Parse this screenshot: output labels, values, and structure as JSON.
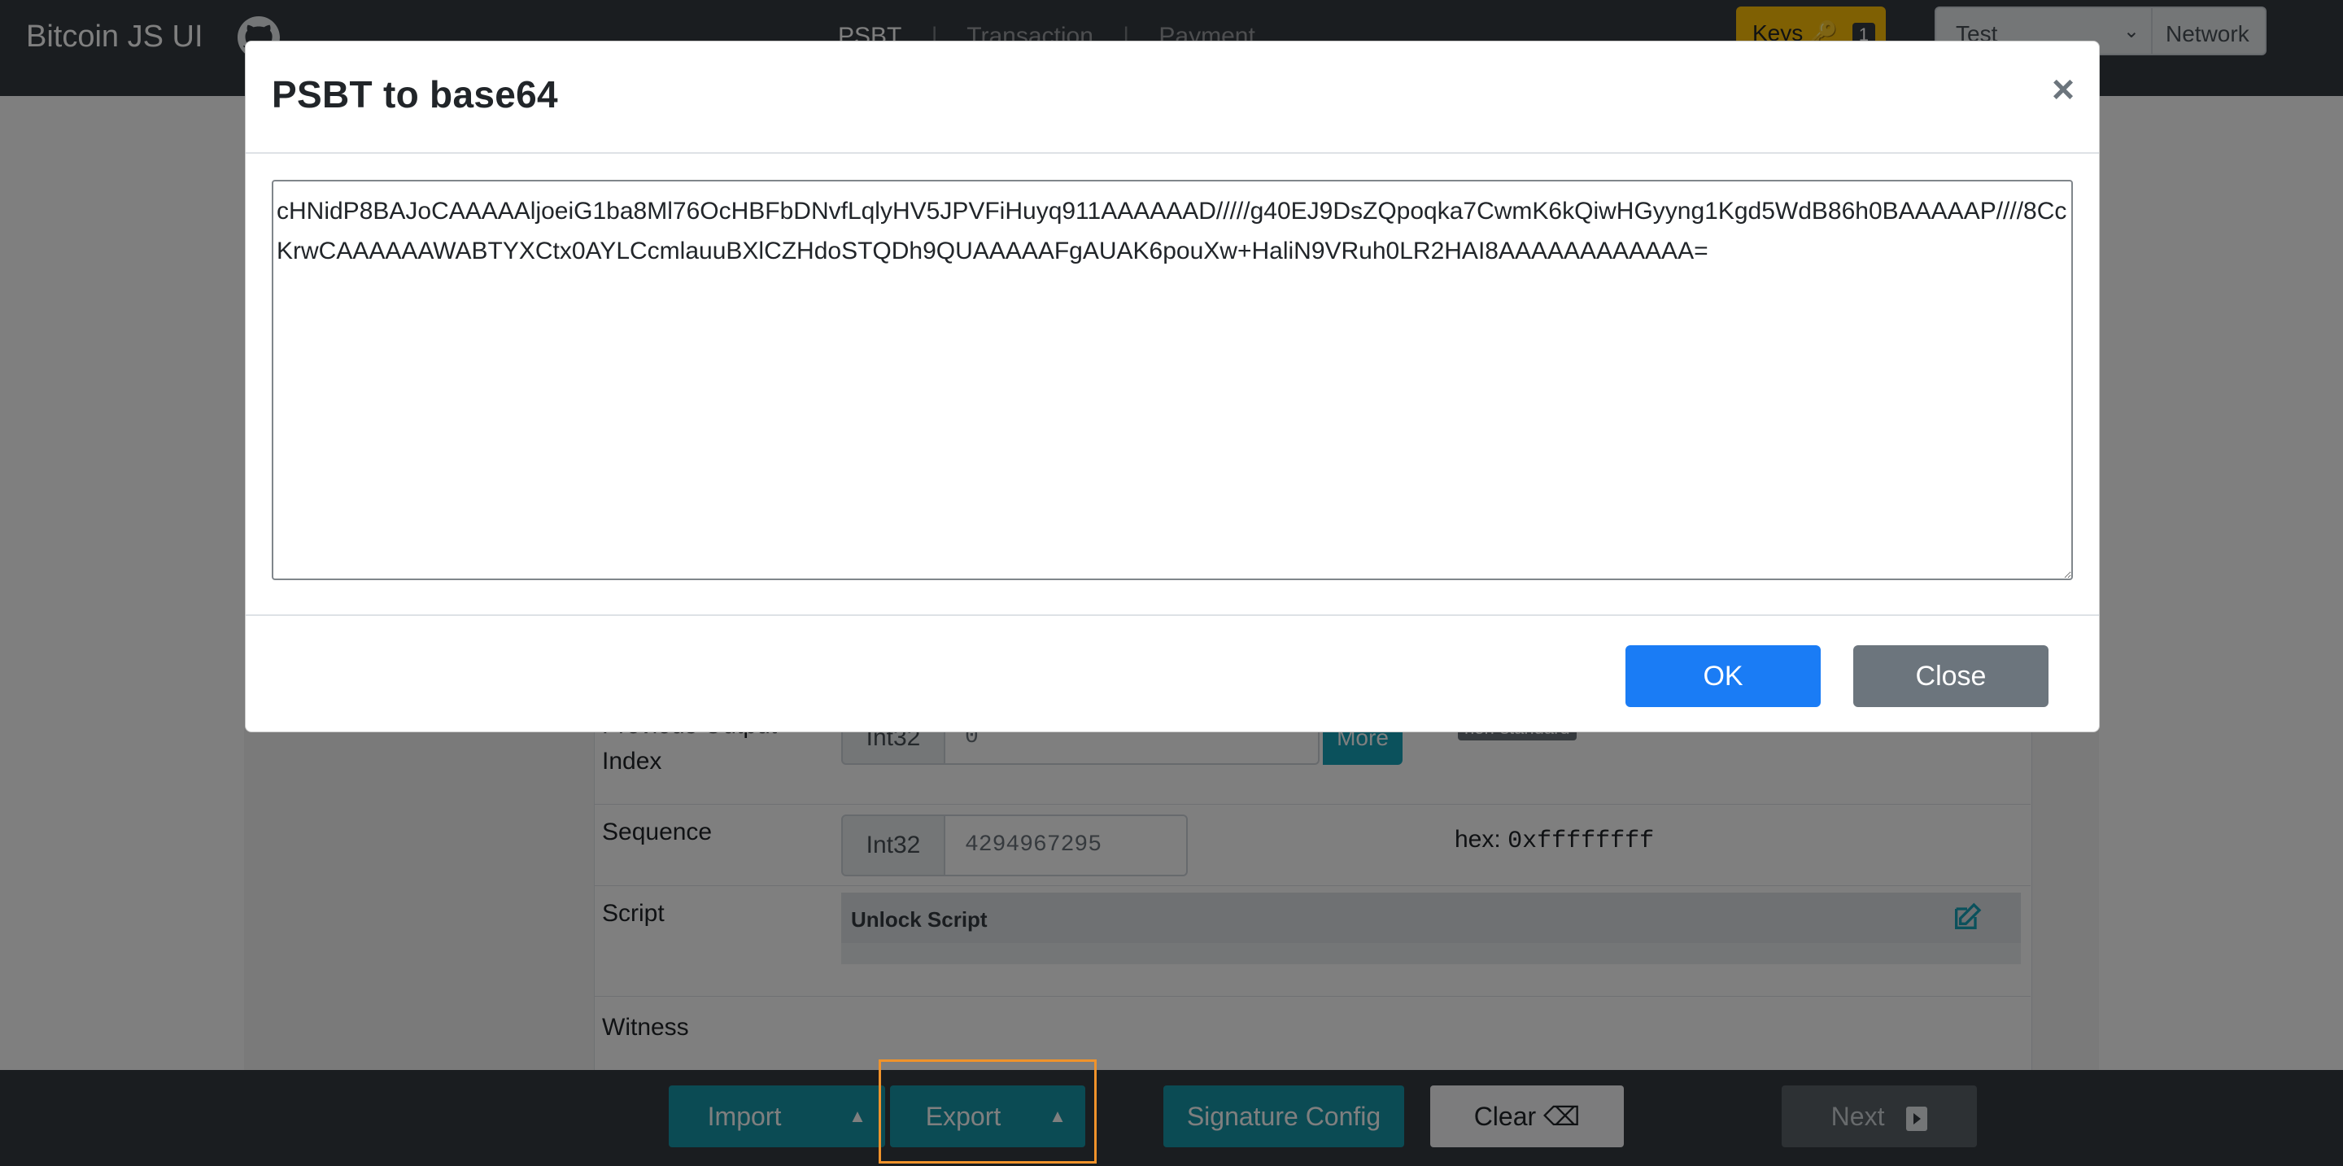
{
  "navbar": {
    "brand": "Bitcoin JS UI",
    "tabs": [
      {
        "label": "PSBT",
        "active": true
      },
      {
        "label": "Transaction",
        "active": false
      },
      {
        "label": "Payment",
        "active": false
      }
    ],
    "separator": "|",
    "keys_label": "Keys",
    "keys_count": "1",
    "network_value": "Test",
    "network_label": "Network"
  },
  "page": {
    "rows": [
      {
        "label": "Previous Output Index",
        "type_label": "Int32",
        "value": "0",
        "more_label": "More",
        "note": "non-standard"
      },
      {
        "label": "Sequence",
        "type_label": "Int32",
        "value": "4294967295",
        "hex_prefix": "hex:",
        "hex_value": "0xffffffff"
      },
      {
        "label": "Script",
        "box_title": "Unlock Script"
      },
      {
        "label": "Witness"
      }
    ]
  },
  "modal": {
    "title": "PSBT to base64",
    "close_symbol": "×",
    "base64": "cHNidP8BAJoCAAAAAljoeiG1ba8Ml76OcHBFbDNvfLqlyHV5JPVFiHuyq911AAAAAAD/////g40EJ9DsZQpoqka7CwmK6kQiwHGyyng1Kgd5WdB86h0BAAAAAP////8CcKrwCAAAAAAWABTYXCtx0AYLCcmlauuBXlCZHdoSTQDh9QUAAAAAFgAUAK6pouXw+HaliN9VRuh0LR2HAI8AAAAAAAAAAAA=",
    "ok_label": "OK",
    "close_label": "Close"
  },
  "bottom_bar": {
    "import_label": "Import",
    "export_label": "Export",
    "signature_label": "Signature Config",
    "clear_label": "Clear",
    "next_label": "Next"
  },
  "colors": {
    "primary": "#1a7cf5",
    "info": "#1797a9",
    "secondary": "#6c757d",
    "warning": "#ffc107",
    "dark": "#343a40",
    "highlight": "#f0932b"
  }
}
